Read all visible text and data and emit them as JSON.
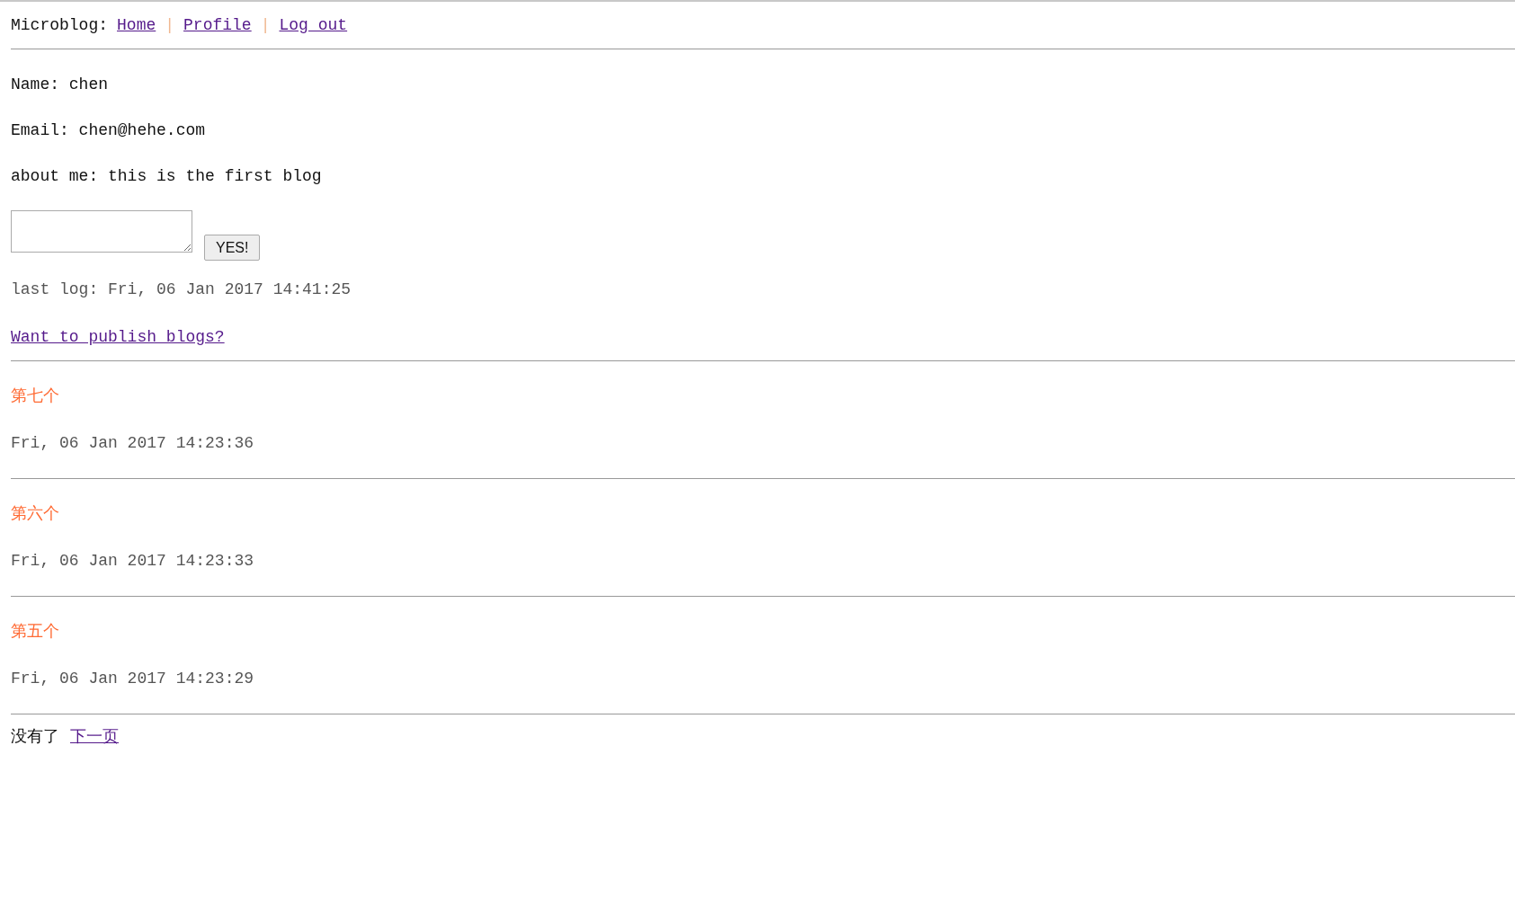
{
  "nav": {
    "brand": "Microblog:",
    "links": [
      {
        "label": "Home"
      },
      {
        "label": "Profile"
      },
      {
        "label": "Log out"
      }
    ],
    "separator": "|"
  },
  "profile": {
    "name": "Name: chen",
    "email": "Email: chen@hehe.com",
    "about": "about me: this is the first blog"
  },
  "form": {
    "button": "YES!"
  },
  "last_log": "last log: Fri, 06 Jan 2017 14:41:25",
  "publish_link": "Want to publish blogs?",
  "posts": [
    {
      "title": "第七个",
      "time": "Fri, 06 Jan 2017 14:23:36"
    },
    {
      "title": "第六个",
      "time": "Fri, 06 Jan 2017 14:23:33"
    },
    {
      "title": "第五个",
      "time": "Fri, 06 Jan 2017 14:23:29"
    }
  ],
  "pager": {
    "text": "没有了",
    "next": "下一页"
  }
}
